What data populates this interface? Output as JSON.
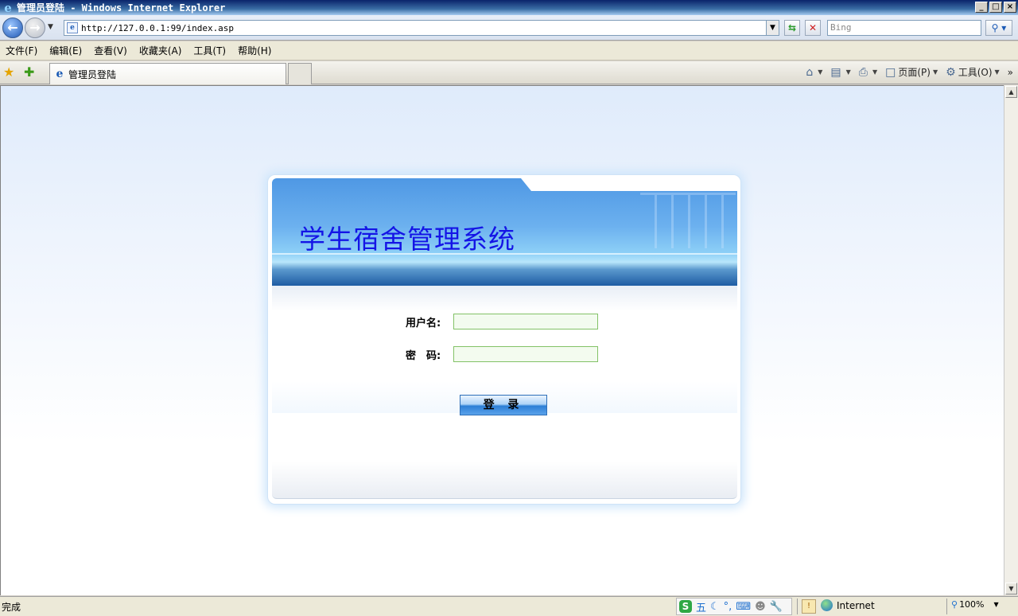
{
  "window": {
    "title": "管理员登陆 - Windows Internet Explorer",
    "controls": [
      "_",
      "□",
      "×"
    ]
  },
  "addressbar": {
    "url": "http://127.0.0.1:99/index.asp",
    "search_placeholder": "Bing"
  },
  "menu": {
    "items": [
      "文件(F)",
      "编辑(E)",
      "查看(V)",
      "收藏夹(A)",
      "工具(T)",
      "帮助(H)"
    ]
  },
  "tabs": {
    "active_tab": "管理员登陆"
  },
  "commandbar": {
    "page_label": "页面(P)",
    "tools_label": "工具(O)"
  },
  "login": {
    "app_title": "学生宿舍管理系统",
    "username_label": "用户名:",
    "password_label": "密　码:",
    "username_value": "",
    "password_value": "",
    "submit_label": "登 录"
  },
  "status": {
    "text": "完成",
    "zone": "Internet",
    "zoom": "100%",
    "ime_label": "五"
  },
  "colors": {
    "title_text": "#1414e6",
    "banner_blue": "#4f98e4",
    "input_border": "#83c267"
  }
}
